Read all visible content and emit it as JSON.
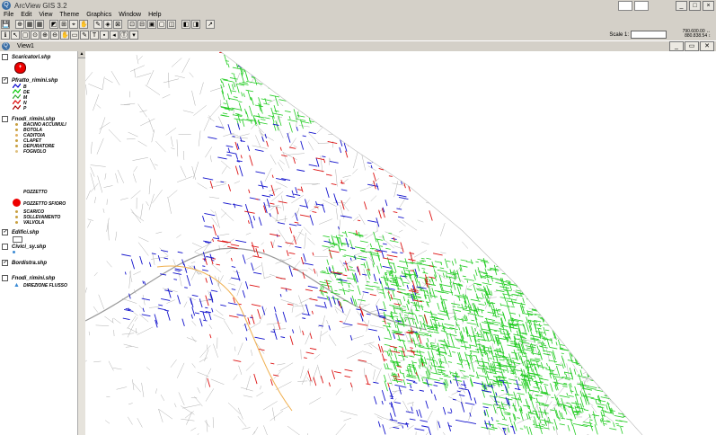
{
  "window": {
    "title": "ArcView GIS 3.2"
  },
  "menu": [
    "File",
    "Edit",
    "View",
    "Theme",
    "Graphics",
    "Window",
    "Help"
  ],
  "toolbar": {
    "buttons1": [
      "💾",
      "⊕",
      "▦",
      "▦",
      "◩",
      "⊞",
      "⌖",
      "✋",
      "✎",
      "◈",
      "⊠",
      "⊡",
      "⊟",
      "▣",
      "▢",
      "◫",
      "◧",
      "◨",
      "↗"
    ],
    "buttons2": [
      "ℹ",
      "↖",
      "▢",
      "⊙",
      "⊕",
      "⊖",
      "✋",
      "▭",
      "✎",
      "T",
      "▪",
      "◂",
      "Ⓣ",
      "▾"
    ]
  },
  "status": {
    "scale_label": "Scale 1:",
    "scale_value": "",
    "coord_x": "790.600.00 ↔",
    "coord_y": "880.838.54 ↕"
  },
  "view": {
    "title": "View1"
  },
  "toc": {
    "themes": [
      {
        "name": "Scaricatori.shp",
        "checked": false
      },
      {
        "name": "Pfratto_rimini.shp",
        "checked": true
      },
      {
        "name": "Fnodi_rimini.shp",
        "checked": false
      },
      {
        "name": "Edifici.shp",
        "checked": true
      },
      {
        "name": "Civici_sy.shp",
        "checked": false
      },
      {
        "name": "Bordistra.shp",
        "checked": true
      },
      {
        "name": "Fnodi_rimini.shp",
        "checked": false
      }
    ],
    "pipe_legend": [
      {
        "label": "B",
        "color": "#0000cc"
      },
      {
        "label": "DE",
        "color": "#00cc00"
      },
      {
        "label": "M",
        "color": "#33aa33"
      },
      {
        "label": "N",
        "color": "#dd0000"
      },
      {
        "label": "P",
        "color": "#aa0000"
      }
    ],
    "node_legend": [
      {
        "label": "BACINO ACCUMULI",
        "color": "#c8a040"
      },
      {
        "label": "BOTOLA",
        "color": "#c8a040"
      },
      {
        "label": "CADITOIA",
        "color": "#e0b060"
      },
      {
        "label": "CLAPET",
        "color": "#c8a040"
      },
      {
        "label": "DEPURATORE",
        "color": "#c8a040"
      },
      {
        "label": "FOGNOLO",
        "color": "#e0c080"
      }
    ],
    "pozzetto": "POZZETTO",
    "pozzetto_sfioro": "POZZETTO SFIORO",
    "node_legend2": [
      {
        "label": "SCARICO",
        "color": "#c8a040"
      },
      {
        "label": "SOLLEVAMENTO",
        "color": "#c8a040"
      },
      {
        "label": "VALVOLA",
        "color": "#c8a040"
      }
    ],
    "flow_label": "DIREZIONE FLUSSO"
  }
}
